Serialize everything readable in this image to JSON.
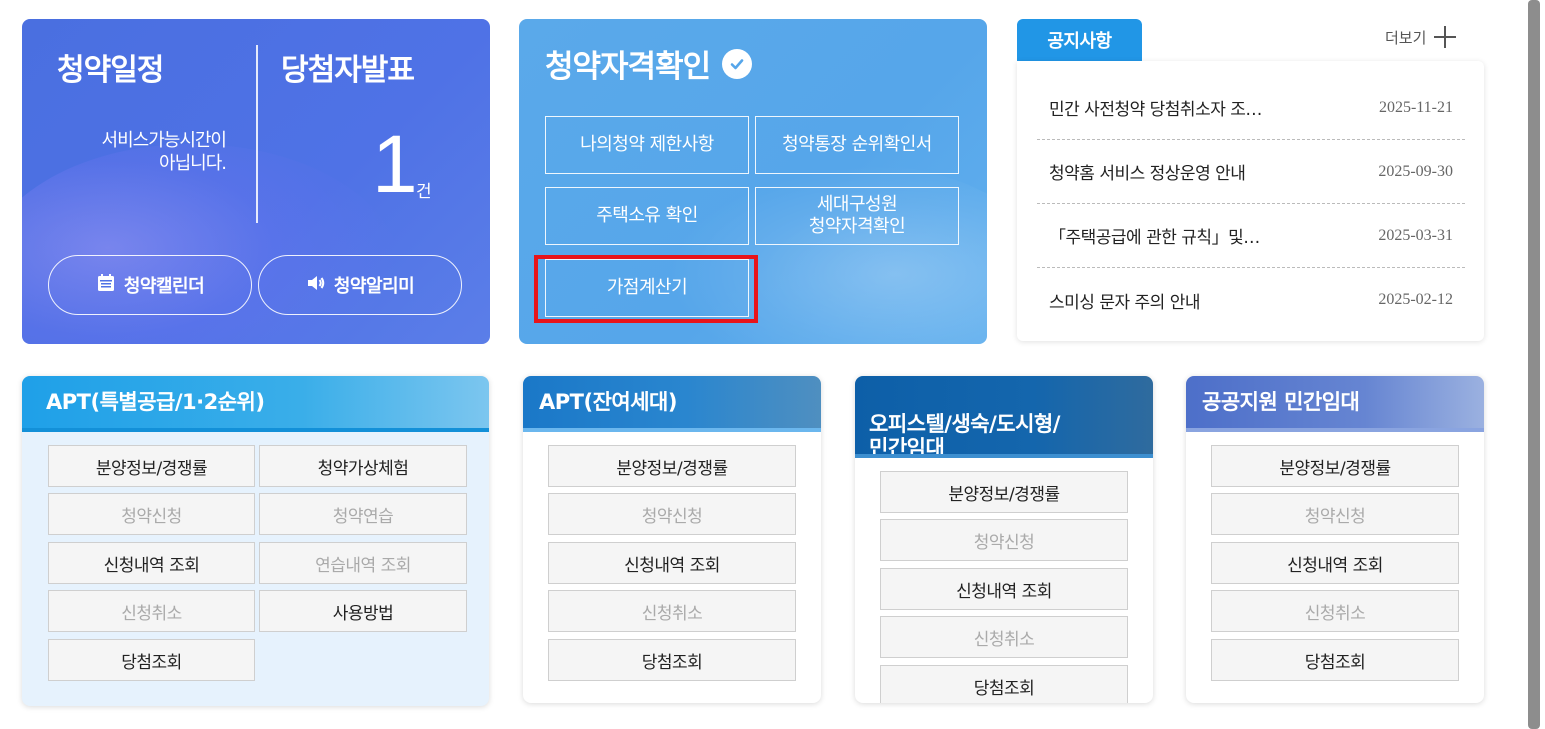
{
  "schedule_card": {
    "title": "청약일정",
    "message_line1": "서비스가능시간이",
    "message_line2": "아닙니다.",
    "calendar_button": "청약캘린더",
    "alarm_button": "청약알리미"
  },
  "winner_card": {
    "title": "당첨자발표",
    "count": "1",
    "unit": "건"
  },
  "qualification_card": {
    "title": "청약자격확인",
    "buttons": [
      "나의청약 제한사항",
      "청약통장 순위확인서",
      "주택소유 확인",
      "세대구성원\n청약자격확인",
      "가점계산기"
    ]
  },
  "notice": {
    "tab_label": "공지사항",
    "more_label": "더보기",
    "items": [
      {
        "title": "민간 사전청약 당첨취소자 조…",
        "date": "2025-11-21"
      },
      {
        "title": "청약홈 서비스 정상운영 안내",
        "date": "2025-09-30"
      },
      {
        "title": "「주택공급에 관한 규칙」및…",
        "date": "2025-03-31"
      },
      {
        "title": "스미싱 문자 주의 안내",
        "date": "2025-02-12"
      }
    ]
  },
  "services": [
    {
      "title": "APT(특별공급/1·2순위)",
      "buttons": [
        {
          "label": "분양정보/경쟁률",
          "enabled": true
        },
        {
          "label": "청약가상체험",
          "enabled": true
        },
        {
          "label": "청약신청",
          "enabled": false
        },
        {
          "label": "청약연습",
          "enabled": false
        },
        {
          "label": "신청내역 조회",
          "enabled": true
        },
        {
          "label": "연습내역 조회",
          "enabled": false
        },
        {
          "label": "신청취소",
          "enabled": false
        },
        {
          "label": "사용방법",
          "enabled": true
        },
        {
          "label": "당첨조회",
          "enabled": true
        }
      ]
    },
    {
      "title": "APT(잔여세대)",
      "buttons": [
        {
          "label": "분양정보/경쟁률",
          "enabled": true
        },
        {
          "label": "청약신청",
          "enabled": false
        },
        {
          "label": "신청내역 조회",
          "enabled": true
        },
        {
          "label": "신청취소",
          "enabled": false
        },
        {
          "label": "당첨조회",
          "enabled": true
        }
      ]
    },
    {
      "title": "오피스텔/생숙/도시형/\n민간임대",
      "buttons": [
        {
          "label": "분양정보/경쟁률",
          "enabled": true
        },
        {
          "label": "청약신청",
          "enabled": false
        },
        {
          "label": "신청내역 조회",
          "enabled": true
        },
        {
          "label": "신청취소",
          "enabled": false
        },
        {
          "label": "당첨조회",
          "enabled": true
        }
      ]
    },
    {
      "title": "공공지원 민간임대",
      "buttons": [
        {
          "label": "분양정보/경쟁률",
          "enabled": true
        },
        {
          "label": "청약신청",
          "enabled": false
        },
        {
          "label": "신청내역 조회",
          "enabled": true
        },
        {
          "label": "신청취소",
          "enabled": false
        },
        {
          "label": "당첨조회",
          "enabled": true
        }
      ]
    }
  ],
  "colors": {
    "schedule_bg": "#4f72e6",
    "qualification_bg": "#56a6ea",
    "notice_tab": "#2196e6",
    "highlight": "#e8141a"
  }
}
